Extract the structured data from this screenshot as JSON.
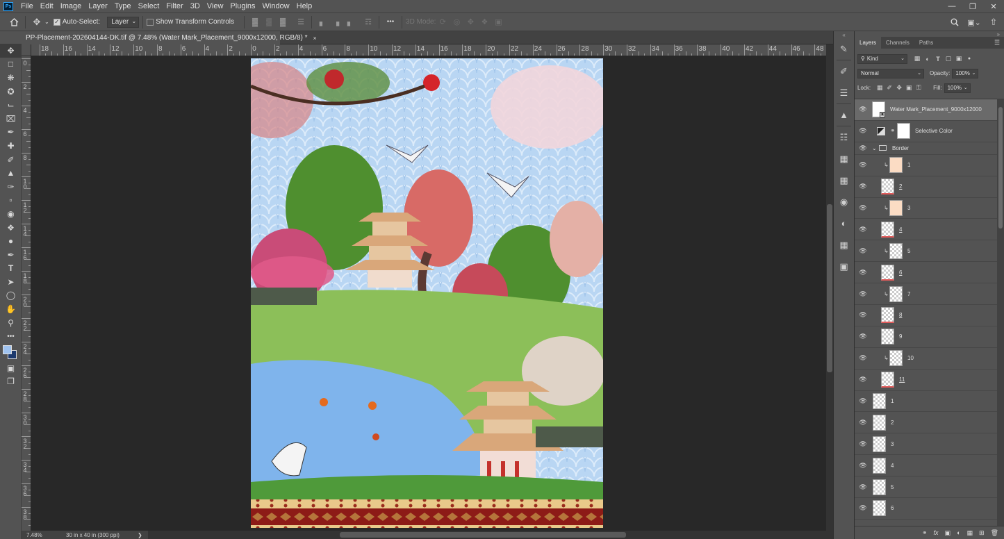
{
  "menu": [
    "File",
    "Edit",
    "Image",
    "Layer",
    "Type",
    "Select",
    "Filter",
    "3D",
    "View",
    "Plugins",
    "Window",
    "Help"
  ],
  "options": {
    "auto_select_label": "Auto-Select:",
    "auto_select_target": "Layer",
    "show_transform_label": "Show Transform Controls",
    "mode_3d_label": "3D Mode:",
    "more": "•••"
  },
  "document": {
    "tab_title": "PP-Placement-202604144-DK.tif @ 7.48% (Water Mark_Placement_9000x12000, RGB/8) *",
    "close": "×"
  },
  "ruler_h_labels": [
    "18",
    "16",
    "14",
    "12",
    "10",
    "8",
    "6",
    "4",
    "2",
    "0",
    "2",
    "4",
    "6",
    "8",
    "10",
    "12",
    "14",
    "16",
    "18",
    "20",
    "22",
    "24",
    "26",
    "28",
    "30",
    "32",
    "34",
    "36",
    "38",
    "40",
    "42",
    "44",
    "46",
    "48"
  ],
  "ruler_v_labels": [
    "0",
    "2",
    "4",
    "6",
    "8",
    "10",
    "12",
    "14",
    "16",
    "18",
    "20",
    "22",
    "24",
    "26",
    "28",
    "30",
    "32",
    "34",
    "36",
    "38"
  ],
  "status": {
    "zoom": "7.48%",
    "doc_info": "30 in x 40 in (300 ppi)",
    "arrow": "❯"
  },
  "panel": {
    "tabs": [
      "Layers",
      "Channels",
      "Paths"
    ],
    "kind": "Kind",
    "blend_mode": "Normal",
    "opacity_label": "Opacity:",
    "opacity": "100%",
    "lock_label": "Lock:",
    "fill_label": "Fill:",
    "fill": "100%"
  },
  "layers": [
    {
      "name": "Water Mark_Placement_9000x12000",
      "thumb": "smart",
      "selected": true
    },
    {
      "name": "Selective Color",
      "thumb": "adjust"
    },
    {
      "name": "Border",
      "thumb": "folder"
    },
    {
      "name": "1",
      "thumb": "peach",
      "clip": true
    },
    {
      "name": "2",
      "thumb": "check",
      "underline": true
    },
    {
      "name": "3",
      "thumb": "peach",
      "clip": true
    },
    {
      "name": "4",
      "thumb": "check",
      "underline": true
    },
    {
      "name": "5",
      "thumb": "check",
      "clip": true
    },
    {
      "name": "6",
      "thumb": "check",
      "underline": true
    },
    {
      "name": "7",
      "thumb": "check",
      "clip": true
    },
    {
      "name": "8",
      "thumb": "check",
      "underline": true
    },
    {
      "name": "9",
      "thumb": "check"
    },
    {
      "name": "10",
      "thumb": "check",
      "clip": true
    },
    {
      "name": "11",
      "thumb": "check",
      "underline": true
    },
    {
      "name": "1",
      "thumb": "check",
      "top": true
    },
    {
      "name": "2",
      "thumb": "check",
      "top": true
    },
    {
      "name": "3",
      "thumb": "check",
      "top": true
    },
    {
      "name": "4",
      "thumb": "check",
      "top": true
    },
    {
      "name": "5",
      "thumb": "check",
      "top": true
    },
    {
      "name": "6",
      "thumb": "check",
      "top": true
    }
  ],
  "colors": {
    "foreground": "#9fc3f0",
    "background": "#1d3a6e",
    "ui_bg": "#535353",
    "canvas_bg": "#282828"
  }
}
